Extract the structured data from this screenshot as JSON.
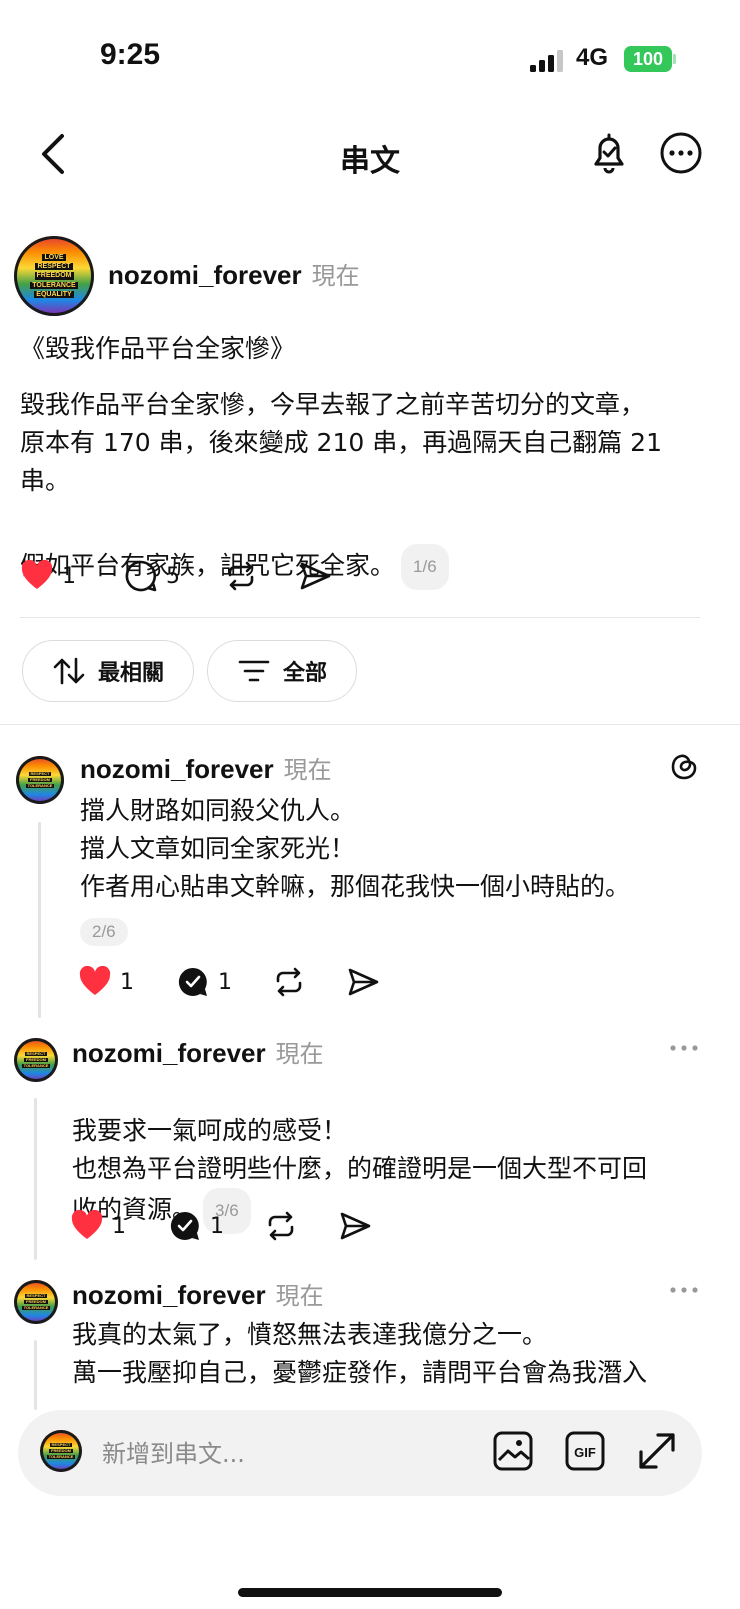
{
  "status_bar": {
    "time": "9:25",
    "network": "4G",
    "battery": "100"
  },
  "header": {
    "title": "串文"
  },
  "avatar_lines": [
    "LOVE",
    "RESPECT",
    "FREEDOM",
    "TOLERANCE",
    "EQUALITY"
  ],
  "main_post": {
    "username": "nozomi_forever",
    "time": "現在",
    "title": "《毀我作品平台全家慘》",
    "paragraph1": "毀我作品平台全家慘，今早去報了之前辛苦切分的文章，\n原本有 170 串，後來變成 210 串，再過隔天自己翻篇 21\n串。",
    "paragraph2": "假如平台有家族，詛咒它死全家。",
    "badge": "1/6",
    "likes": "1",
    "comments": "5"
  },
  "filters": {
    "sort_label": "最相關",
    "filter_label": "全部"
  },
  "replies": [
    {
      "username": "nozomi_forever",
      "time": "現在",
      "text": "擋人財路如同殺父仇人。\n擋人文章如同全家死光！\n作者用心貼串文幹嘛，那個花我快一個小時貼的。",
      "badge": "2/6",
      "likes": "1",
      "comments": "1"
    },
    {
      "username": "nozomi_forever",
      "time": "現在",
      "text": "我要求一氣呵成的感受！\n也想為平台證明些什麼，的確證明是一個大型不可回\n收的資源。",
      "badge": "3/6",
      "likes": "1",
      "comments": "1"
    },
    {
      "username": "nozomi_forever",
      "time": "現在",
      "text": "我真的太氣了，憤怒無法表達我億分之一。\n萬一我壓抑自己，憂鬱症發作，請問平台會為我潛入"
    }
  ],
  "composer": {
    "placeholder": "新增到串文..."
  },
  "colors": {
    "like_red": "#ff3040",
    "battery_green": "#34c759",
    "muted": "#999999"
  }
}
